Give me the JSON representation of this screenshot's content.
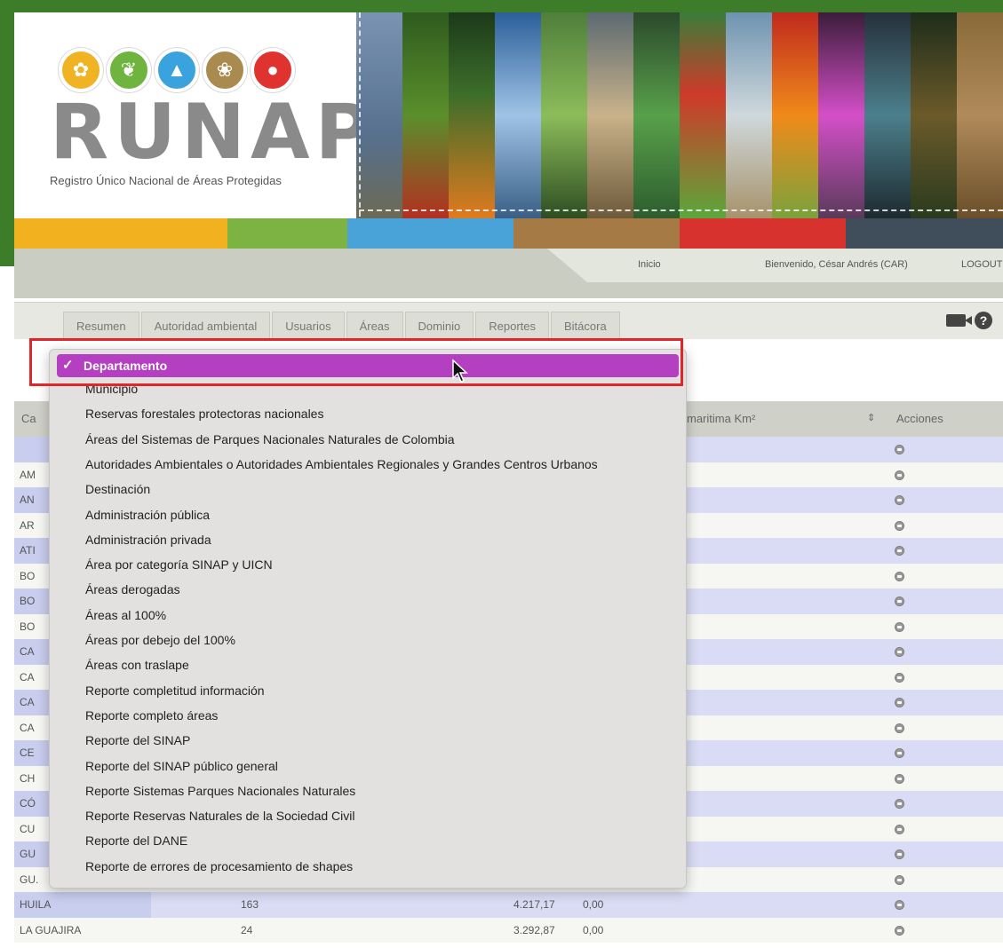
{
  "brand": {
    "logo_text": "RUNAP",
    "subtitle": "Registro Único Nacional de Áreas Protegidas"
  },
  "topbar": {
    "inicio": "Inicio",
    "welcome": "Bienvenido, César Andrés (CAR)",
    "logout": "LOGOUT"
  },
  "nav": {
    "tabs": [
      "Resumen",
      "Autoridad ambiental",
      "Usuarios",
      "Áreas",
      "Dominio",
      "Reportes",
      "Bitácora"
    ]
  },
  "table": {
    "header_first_partial": "Ca",
    "header_marine": "maritima Km²",
    "header_sort_icon": "⇕",
    "header_actions": "Acciones",
    "rows": [
      {
        "name": ""
      },
      {
        "name": "AM"
      },
      {
        "name": "AN"
      },
      {
        "name": "AR"
      },
      {
        "name": "ATI"
      },
      {
        "name": "BO"
      },
      {
        "name": "BO"
      },
      {
        "name": "BO"
      },
      {
        "name": "CA"
      },
      {
        "name": "CA"
      },
      {
        "name": "CA"
      },
      {
        "name": "CA"
      },
      {
        "name": "CE"
      },
      {
        "name": "CH"
      },
      {
        "name": "CÓ"
      },
      {
        "name": "CU"
      },
      {
        "name": "GU"
      },
      {
        "name": "GU."
      },
      {
        "name": "HUILA",
        "count": "163",
        "area": "4.217,17",
        "marine": "0,00"
      },
      {
        "name": "LA GUAJIRA",
        "count": "24",
        "area": "3.292,87",
        "marine": "0,00"
      }
    ]
  },
  "dropdown": {
    "selected": "Departamento",
    "check": "✓",
    "items": [
      "Municipio",
      "Reservas forestales protectoras nacionales",
      "Áreas del Sistemas de Parques Nacionales Naturales de Colombia",
      "Autoridades Ambientales o Autoridades Ambientales Regionales y Grandes Centros Urbanos",
      "Destinación",
      "Administración pública",
      "Administración privada",
      "Área por categoría SINAP y UICN",
      "Áreas derogadas",
      "Áreas al 100%",
      "Áreas por debejo del 100%",
      "Áreas con traslape",
      "Reporte completitud información",
      "Reporte completo áreas",
      "Reporte del SINAP",
      "Reporte del SINAP público general",
      "Reporte Sistemas Parques Nacionales Naturales",
      "Reporte Reservas Naturales de la Sociedad Civil",
      "Reporte del DANE",
      "Reporte de errores de procesamiento de shapes"
    ]
  },
  "colors": {
    "accent_selected": "#b440c1",
    "highlight_border": "#e0262a",
    "stripe": [
      "#f2b21f",
      "#7cb342",
      "#4aa3d8",
      "#a57a45",
      "#d8322f",
      "#3f4e5a"
    ]
  },
  "icons": [
    "video-camera-icon",
    "help-icon",
    "action-icon",
    "check-icon",
    "cursor-icon"
  ]
}
